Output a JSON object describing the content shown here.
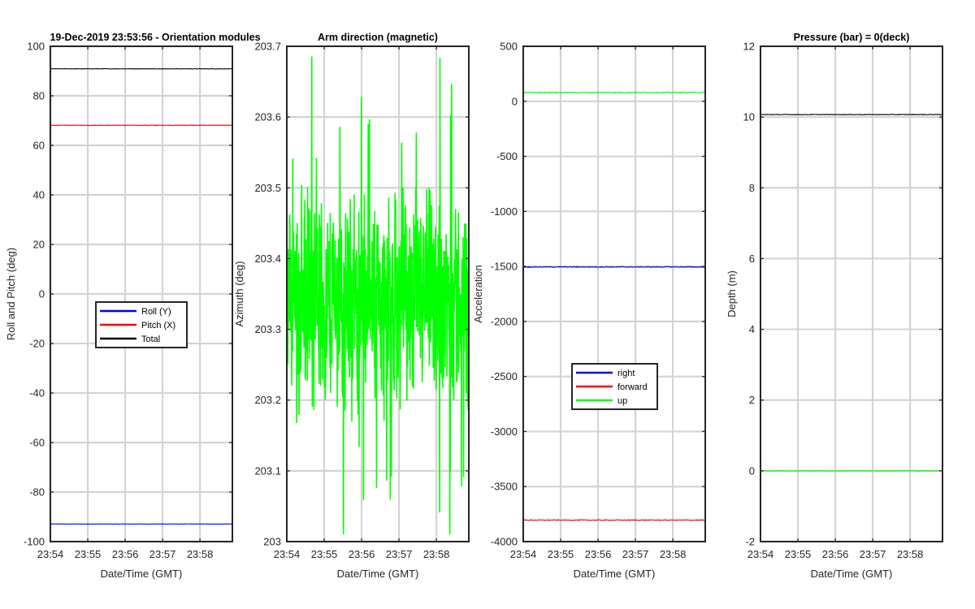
{
  "chart_data": [
    {
      "type": "line",
      "title": "19-Dec-2019 23:53:56 - Orientation modules",
      "xlabel": "Date/Time (GMT)",
      "ylabel": "Roll and Pitch (deg)",
      "x_ticks": [
        "23:54",
        "23:55",
        "23:56",
        "23:57",
        "23:58"
      ],
      "xlim": [
        "23:54",
        "23:58:52"
      ],
      "ylim": [
        -100,
        100
      ],
      "y_ticks": [
        -100,
        -80,
        -60,
        -40,
        -20,
        0,
        20,
        40,
        60,
        80,
        100
      ],
      "grid": true,
      "legend": "center",
      "series": [
        {
          "name": "Roll (Y)",
          "color": "#0000ff",
          "values": [
            -92.9
          ],
          "noise": 0.08
        },
        {
          "name": "Pitch (X)",
          "color": "#ff0000",
          "values": [
            68.1
          ],
          "noise": 0.1
        },
        {
          "name": "Total",
          "color": "#000000",
          "values": [
            90.9
          ],
          "noise": 0.08
        }
      ]
    },
    {
      "type": "line",
      "title": "Arm direction (magnetic)",
      "xlabel": "Date/Time (GMT)",
      "ylabel": "Azimuth (deg)",
      "x_ticks": [
        "23:54",
        "23:55",
        "23:56",
        "23:57",
        "23:58"
      ],
      "xlim": [
        "23:54",
        "23:58:52"
      ],
      "ylim": [
        203,
        203.7
      ],
      "y_ticks": [
        203,
        203.1,
        203.2,
        203.3,
        203.4,
        203.5,
        203.6,
        203.7
      ],
      "grid": true,
      "series": [
        {
          "color": "#00ff00",
          "values": [
            203.34
          ],
          "noise": 0.13,
          "min": 203.01,
          "max": 203.69
        }
      ]
    },
    {
      "type": "line",
      "xlabel": "Date/Time (GMT)",
      "ylabel": "Acceleration",
      "x_ticks": [
        "23:54",
        "23:55",
        "23:56",
        "23:57",
        "23:58"
      ],
      "xlim": [
        "23:54",
        "23:58:52"
      ],
      "ylim": [
        -4000,
        500
      ],
      "y_ticks": [
        -4000,
        -3500,
        -3000,
        -2500,
        -2000,
        -1500,
        -1000,
        -500,
        0,
        500
      ],
      "grid": true,
      "legend": "lower-center",
      "series": [
        {
          "name": "right",
          "color": "#0000ff",
          "values": [
            -1505
          ],
          "noise": 4
        },
        {
          "name": "forward",
          "color": "#ff0000",
          "values": [
            -3805
          ],
          "noise": 4
        },
        {
          "name": "up",
          "color": "#00ff00",
          "values": [
            80
          ],
          "noise": 4
        }
      ]
    },
    {
      "type": "line",
      "title": "Pressure (bar) = 0(deck)",
      "xlabel": "Date/Time (GMT)",
      "ylabel": "Depth (m)",
      "x_ticks": [
        "23:54",
        "23:55",
        "23:56",
        "23:57",
        "23:58"
      ],
      "xlim": [
        "23:54",
        "23:58:52"
      ],
      "ylim": [
        -2,
        12
      ],
      "y_ticks": [
        -2,
        0,
        2,
        4,
        6,
        8,
        10,
        12
      ],
      "grid": true,
      "series": [
        {
          "color": "#000000",
          "values": [
            10.07
          ],
          "noise": 0.008
        },
        {
          "color": "#00ff00",
          "values": [
            0.0
          ],
          "noise": 0.008
        }
      ]
    }
  ]
}
